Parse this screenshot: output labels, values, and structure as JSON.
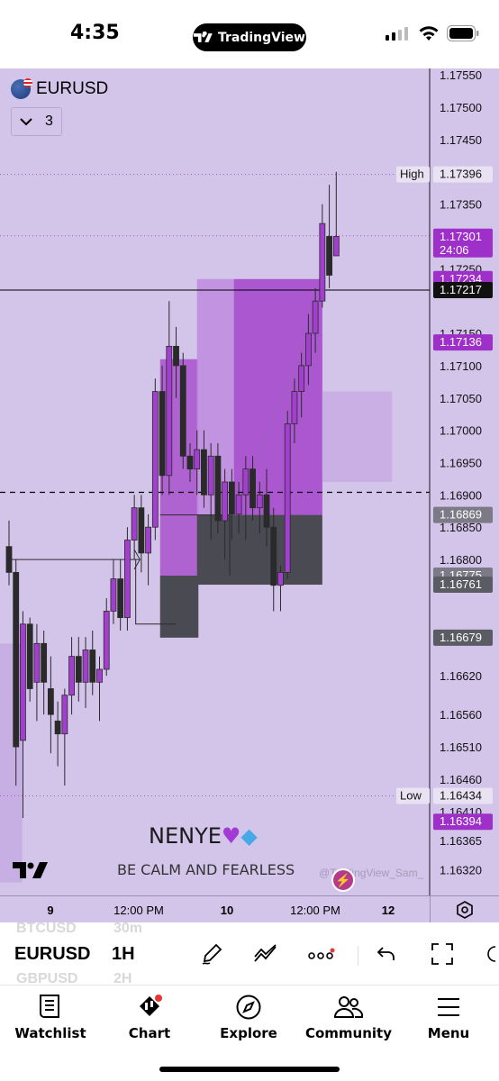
{
  "status": {
    "time": "4:35",
    "app_pill": "TradingView"
  },
  "chart": {
    "symbol": "EURUSD",
    "interval_count": "3",
    "watermark_name": "NENYE",
    "watermark_quote": "BE CALM AND FEARLESS",
    "watermark_user": "@TradingView_Sam_",
    "colors": {
      "background": "#d3c4e9",
      "candle": "#2a2a2a",
      "zone_purple": "#9b30c4",
      "zone_dark": "#4a4a52",
      "label_purple": "#9e2fc9",
      "label_grey": "#5b5b63"
    }
  },
  "chart_data": {
    "type": "candlestick",
    "ylim": [
      1.1628,
      1.1756
    ],
    "price_axis_ticks": [
      "1.17550",
      "1.17500",
      "1.17450",
      "1.17350",
      "1.17250",
      "1.17150",
      "1.17100",
      "1.17050",
      "1.17000",
      "1.16950",
      "1.16900",
      "1.16850",
      "1.16800",
      "1.16620",
      "1.16560",
      "1.16510",
      "1.16460",
      "1.16410",
      "1.16365",
      "1.16320"
    ],
    "x_ticks": [
      "9",
      "12:00 PM",
      "10",
      "12:00 PM",
      "12"
    ],
    "price_labels": [
      {
        "name": "High",
        "value": "1.17396",
        "style": "light"
      },
      {
        "name": "",
        "value": "1.17301",
        "extra": "24:06",
        "style": "purple"
      },
      {
        "name": "",
        "value": "1.17234",
        "style": "purple"
      },
      {
        "name": "",
        "value": "1.17217",
        "style": "black"
      },
      {
        "name": "",
        "value": "1.17136",
        "style": "purple"
      },
      {
        "name": "",
        "value": "1.16869",
        "style": "grey"
      },
      {
        "name": "",
        "value": "1.16775",
        "style": "grey"
      },
      {
        "name": "",
        "value": "1.16761",
        "style": "darkgrey"
      },
      {
        "name": "",
        "value": "1.16679",
        "style": "darkgrey"
      },
      {
        "name": "Low",
        "value": "1.16434",
        "style": "light"
      },
      {
        "name": "",
        "value": "1.16394",
        "style": "purple"
      }
    ],
    "candles": [
      {
        "o": 1.1682,
        "h": 1.1686,
        "l": 1.1676,
        "c": 1.1678
      },
      {
        "o": 1.1678,
        "h": 1.168,
        "l": 1.1645,
        "c": 1.1651
      },
      {
        "o": 1.1652,
        "h": 1.1672,
        "l": 1.164,
        "c": 1.167
      },
      {
        "o": 1.167,
        "h": 1.1671,
        "l": 1.1658,
        "c": 1.166
      },
      {
        "o": 1.1661,
        "h": 1.167,
        "l": 1.1655,
        "c": 1.1667
      },
      {
        "o": 1.1667,
        "h": 1.1669,
        "l": 1.1656,
        "c": 1.1661
      },
      {
        "o": 1.166,
        "h": 1.1665,
        "l": 1.165,
        "c": 1.1656
      },
      {
        "o": 1.1655,
        "h": 1.1658,
        "l": 1.1648,
        "c": 1.1653
      },
      {
        "o": 1.1653,
        "h": 1.166,
        "l": 1.1645,
        "c": 1.1659
      },
      {
        "o": 1.1659,
        "h": 1.1668,
        "l": 1.1656,
        "c": 1.1665
      },
      {
        "o": 1.1665,
        "h": 1.1668,
        "l": 1.1658,
        "c": 1.1661
      },
      {
        "o": 1.1661,
        "h": 1.1668,
        "l": 1.1657,
        "c": 1.1666
      },
      {
        "o": 1.1666,
        "h": 1.1669,
        "l": 1.1659,
        "c": 1.1661
      },
      {
        "o": 1.1661,
        "h": 1.1665,
        "l": 1.1655,
        "c": 1.1663
      },
      {
        "o": 1.1663,
        "h": 1.1674,
        "l": 1.1662,
        "c": 1.1672
      },
      {
        "o": 1.1672,
        "h": 1.168,
        "l": 1.167,
        "c": 1.1677
      },
      {
        "o": 1.1677,
        "h": 1.168,
        "l": 1.1669,
        "c": 1.1671
      },
      {
        "o": 1.1671,
        "h": 1.1685,
        "l": 1.1669,
        "c": 1.1683
      },
      {
        "o": 1.1683,
        "h": 1.169,
        "l": 1.168,
        "c": 1.1688
      },
      {
        "o": 1.1688,
        "h": 1.169,
        "l": 1.1678,
        "c": 1.1681
      },
      {
        "o": 1.1681,
        "h": 1.1687,
        "l": 1.1676,
        "c": 1.1685
      },
      {
        "o": 1.1685,
        "h": 1.1708,
        "l": 1.1683,
        "c": 1.1706
      },
      {
        "o": 1.1706,
        "h": 1.171,
        "l": 1.169,
        "c": 1.1693
      },
      {
        "o": 1.1693,
        "h": 1.172,
        "l": 1.169,
        "c": 1.1713
      },
      {
        "o": 1.1713,
        "h": 1.1716,
        "l": 1.1705,
        "c": 1.171
      },
      {
        "o": 1.171,
        "h": 1.1712,
        "l": 1.1694,
        "c": 1.1696
      },
      {
        "o": 1.1696,
        "h": 1.1698,
        "l": 1.1692,
        "c": 1.1694
      },
      {
        "o": 1.1694,
        "h": 1.17,
        "l": 1.169,
        "c": 1.1697
      },
      {
        "o": 1.1697,
        "h": 1.17,
        "l": 1.1688,
        "c": 1.169
      },
      {
        "o": 1.169,
        "h": 1.1698,
        "l": 1.1683,
        "c": 1.1696
      },
      {
        "o": 1.1696,
        "h": 1.1698,
        "l": 1.1684,
        "c": 1.1686
      },
      {
        "o": 1.1686,
        "h": 1.1694,
        "l": 1.168,
        "c": 1.1692
      },
      {
        "o": 1.1692,
        "h": 1.1694,
        "l": 1.1683,
        "c": 1.1687
      },
      {
        "o": 1.1687,
        "h": 1.1692,
        "l": 1.1684,
        "c": 1.169
      },
      {
        "o": 1.169,
        "h": 1.1696,
        "l": 1.1683,
        "c": 1.1694
      },
      {
        "o": 1.1694,
        "h": 1.1696,
        "l": 1.1686,
        "c": 1.1688
      },
      {
        "o": 1.1688,
        "h": 1.1692,
        "l": 1.1684,
        "c": 1.169
      },
      {
        "o": 1.169,
        "h": 1.1694,
        "l": 1.1682,
        "c": 1.1685
      },
      {
        "o": 1.1685,
        "h": 1.1688,
        "l": 1.1672,
        "c": 1.1676
      },
      {
        "o": 1.1676,
        "h": 1.1679,
        "l": 1.1672,
        "c": 1.1678
      },
      {
        "o": 1.1678,
        "h": 1.1703,
        "l": 1.1677,
        "c": 1.1701
      },
      {
        "o": 1.1701,
        "h": 1.1708,
        "l": 1.1698,
        "c": 1.1706
      },
      {
        "o": 1.1706,
        "h": 1.1712,
        "l": 1.1702,
        "c": 1.171
      },
      {
        "o": 1.171,
        "h": 1.1718,
        "l": 1.1707,
        "c": 1.1715
      },
      {
        "o": 1.1715,
        "h": 1.1722,
        "l": 1.1712,
        "c": 1.172
      },
      {
        "o": 1.172,
        "h": 1.1735,
        "l": 1.1719,
        "c": 1.1732
      },
      {
        "o": 1.173,
        "h": 1.1738,
        "l": 1.1722,
        "c": 1.1724
      },
      {
        "o": 1.1727,
        "h": 1.174,
        "l": 1.1727,
        "c": 1.173
      }
    ]
  },
  "time_axis": {
    "settings_icon": "hexagon-gear-icon"
  },
  "toolbar": {
    "symbol": "EURUSD",
    "interval": "1H",
    "ghost_symbol_above": "BTCUSD",
    "ghost_interval_above": "30m",
    "ghost_symbol_below": "GBPUSD",
    "ghost_interval_below": "2H"
  },
  "tabs": [
    {
      "label": "Watchlist",
      "icon": "list-book-icon"
    },
    {
      "label": "Chart",
      "icon": "chart-icon"
    },
    {
      "label": "Explore",
      "icon": "compass-icon"
    },
    {
      "label": "Community",
      "icon": "people-icon"
    },
    {
      "label": "Menu",
      "icon": "hamburger-icon"
    }
  ]
}
